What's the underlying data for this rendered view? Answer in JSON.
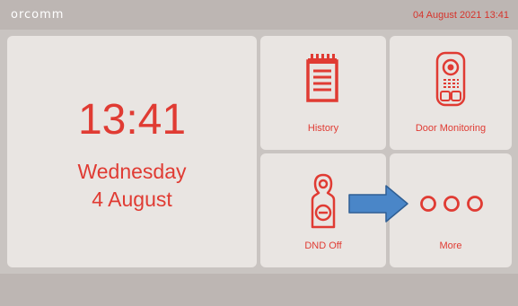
{
  "header": {
    "brand": "orcomm",
    "datetime": "04 August 2021 13:41"
  },
  "clock": {
    "time": "13:41",
    "weekday": "Wednesday",
    "date": "4 August"
  },
  "tiles": [
    {
      "label": "History",
      "icon": "notepad-icon"
    },
    {
      "label": "Door Monitoring",
      "icon": "intercom-icon"
    },
    {
      "label": "DND Off",
      "icon": "door-hanger-icon"
    },
    {
      "label": "More",
      "icon": "three-dots-icon"
    }
  ],
  "colors": {
    "accent": "#e03b33",
    "tile": "#e9e5e2",
    "bar": "#bdb6b3",
    "arrow": "#4a86c8"
  }
}
